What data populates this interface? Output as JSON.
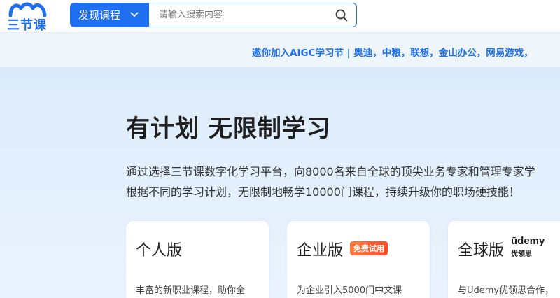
{
  "header": {
    "logo_text": "三节课",
    "search": {
      "category_label": "发现课程",
      "placeholder": "请输入搜索内容",
      "value": ""
    }
  },
  "notice": {
    "text": "邀你加入AIGC学习节 | 奥迪，中粮，联想，金山办公，网易游戏，"
  },
  "hero": {
    "title": "有计划 无限制学习",
    "description_line1": "通过选择三节课数字化学习平台，向8000名来自全球的顶尖业务专家和管理专家学",
    "description_line2": "根据不同的学习计划，无限制地畅学10000门课程，持续升级你的职场硬技能！"
  },
  "cards": [
    {
      "title": "个人版",
      "description": "丰富的新职业课程，助你全"
    },
    {
      "title": "企业版",
      "badge": "免费试用",
      "description": "为企业引入5000门中文课"
    },
    {
      "title": "全球版",
      "brand_name": "ūdemy",
      "brand_sub": "优领思",
      "description": "与Udemy优领思合作，"
    }
  ],
  "colors": {
    "brand_blue": "#1e6ef0",
    "notice_bg": "#eef6fc",
    "hero_bg": "#dcebfb",
    "badge_orange": "#ff5a2e"
  },
  "icons": {
    "logo": "wave-logo-icon",
    "dropdown": "chevron-down-icon",
    "search": "search-icon"
  }
}
